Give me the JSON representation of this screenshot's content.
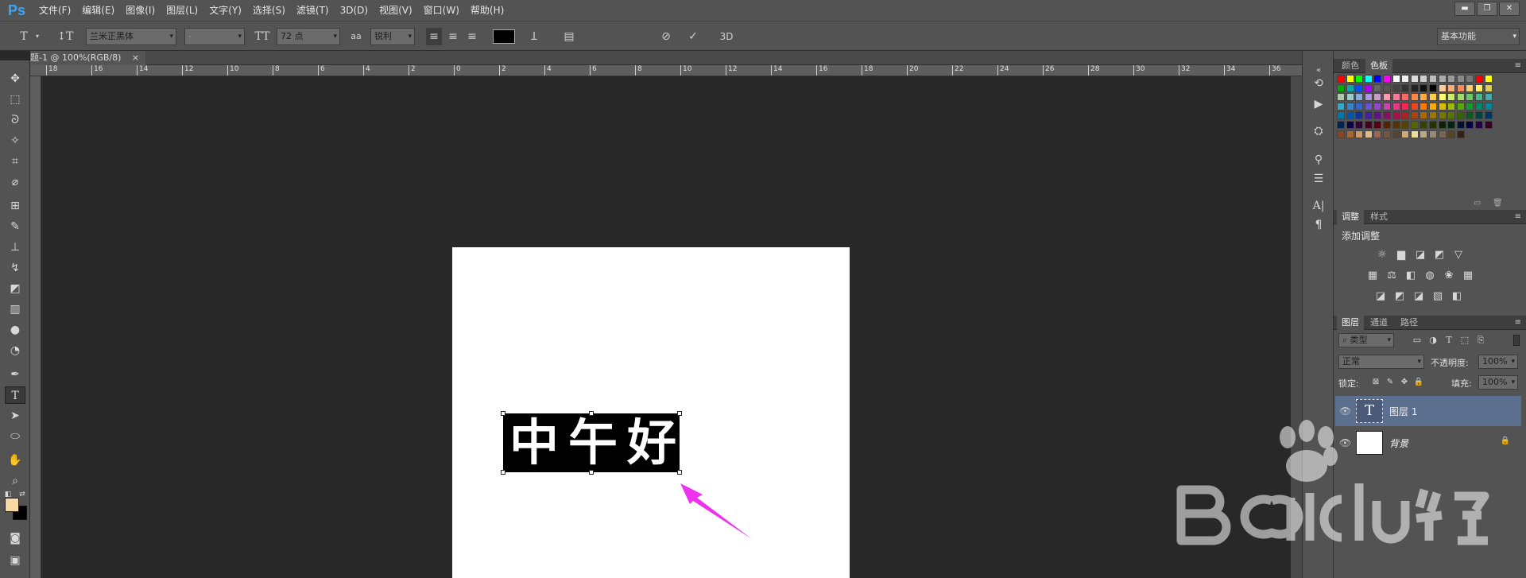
{
  "app": {
    "logo": "Ps"
  },
  "menu": [
    "文件(F)",
    "编辑(E)",
    "图像(I)",
    "图层(L)",
    "文字(Y)",
    "选择(S)",
    "滤镜(T)",
    "3D(D)",
    "视图(V)",
    "窗口(W)",
    "帮助(H)"
  ],
  "window_controls": {
    "minimize": "▬",
    "restore": "❐",
    "close": "✕"
  },
  "options": {
    "font_family": "兰米正黑体",
    "font_style": "-",
    "font_size": "72 点",
    "aa_label": "aa",
    "antialias": "锐利",
    "workspace": "基本功能",
    "three_d": "3D",
    "text_color": "#000000"
  },
  "document": {
    "tab_title": "题-1 @ 100%(RGB/8)",
    "close": "×",
    "ruler_ticks": [
      "18",
      "16",
      "14",
      "12",
      "10",
      "8",
      "6",
      "4",
      "2",
      "0",
      "2",
      "4",
      "6",
      "8",
      "10",
      "12",
      "14",
      "16",
      "18",
      "20",
      "22",
      "24",
      "26",
      "28",
      "30",
      "32",
      "34",
      "36"
    ],
    "text": "中午好",
    "background": "#ffffff",
    "selection_color": "#000000"
  },
  "colors": {
    "foreground": "#f9d8a6",
    "background": "#000000",
    "arrow": "#ee33ee",
    "logo": "#3aa6f5"
  },
  "panels": {
    "color_tabs": [
      "颜色",
      "色板"
    ],
    "adjust_tabs": [
      "调整",
      "样式"
    ],
    "adjust_title": "添加调整",
    "layer_tabs": [
      "图层",
      "通道",
      "路径"
    ],
    "filter_kind": "类型",
    "blend_mode": "正常",
    "opacity_label": "不透明度:",
    "opacity": "100%",
    "lock_label": "锁定:",
    "fill_label": "填充:",
    "fill": "100%",
    "layers": [
      {
        "name": "图层 1",
        "thumb": "T"
      },
      {
        "name": "背景"
      }
    ]
  },
  "swatch_rows": [
    [
      "#ff0000",
      "#ffff00",
      "#00ff00",
      "#00ffff",
      "#0000ff",
      "#ff00ff",
      "#ffffff",
      "#eeeeee",
      "#dddddd",
      "#cccccc",
      "#bbbbbb",
      "#aaaaaa",
      "#999999",
      "#888888",
      "#777777",
      "#ff0000",
      "#ffff00"
    ],
    [
      "#00aa00",
      "#00aaaa",
      "#0055ff",
      "#aa00ff",
      "#666666",
      "#555555",
      "#444444",
      "#333333",
      "#222222",
      "#111111",
      "#000000",
      "#ffcc99",
      "#ffaa77",
      "#ff8855",
      "#ffcc66",
      "#ffee66",
      "#ddcc55"
    ],
    [
      "#aaccaa",
      "#99cccc",
      "#88aadd",
      "#aa99dd",
      "#cc99cc",
      "#ff99aa",
      "#ff7799",
      "#ff6666",
      "#ff8844",
      "#ffaa44",
      "#ffcc44",
      "#ffff66",
      "#ccee66",
      "#99dd66",
      "#66cc66",
      "#44bb88",
      "#44aaaa"
    ],
    [
      "#33aacc",
      "#3388cc",
      "#3366cc",
      "#6655cc",
      "#9944cc",
      "#cc44aa",
      "#ee3388",
      "#ff2255",
      "#ee4422",
      "#ff7700",
      "#ffaa00",
      "#ddbb00",
      "#99bb00",
      "#55aa00",
      "#119933",
      "#008866",
      "#008899"
    ],
    [
      "#0077aa",
      "#0055aa",
      "#113399",
      "#442299",
      "#661188",
      "#881166",
      "#aa1144",
      "#aa2222",
      "#aa4411",
      "#aa6600",
      "#997700",
      "#777700",
      "#557700",
      "#336600",
      "#115522",
      "#004444",
      "#003366"
    ],
    [
      "#002255",
      "#110044",
      "#330033",
      "#440022",
      "#550011",
      "#552200",
      "#553300",
      "#554400",
      "#556600",
      "#334400",
      "#223300",
      "#112200",
      "#002211",
      "#001133",
      "#000044",
      "#220044",
      "#330022"
    ],
    [
      "#884422",
      "#aa6633",
      "#cc9966",
      "#ddbb88",
      "#996655",
      "#775544",
      "#554433",
      "#ccaa77",
      "#eedd99",
      "#bbaa88",
      "#998877",
      "#776655",
      "#554422",
      "#332211"
    ]
  ]
}
